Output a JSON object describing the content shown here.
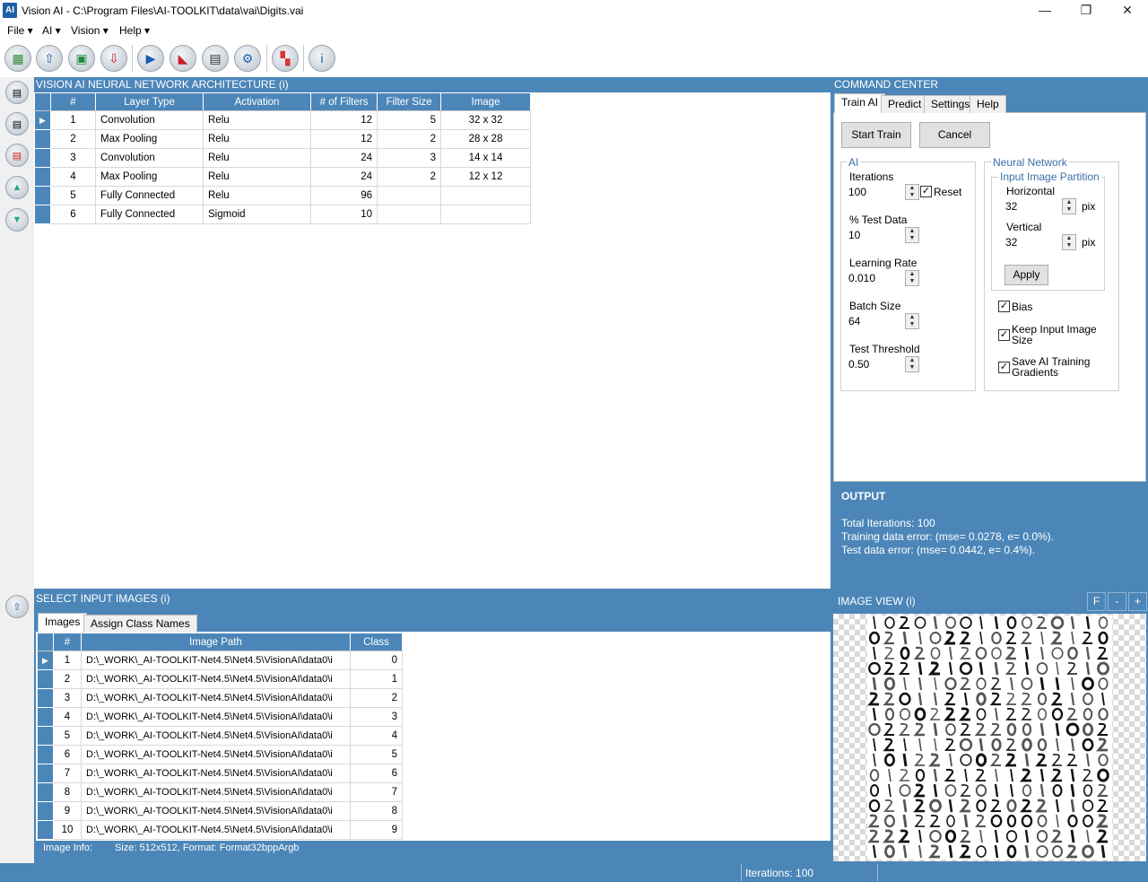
{
  "window": {
    "app_icon": "AI",
    "title": "Vision AI - C:\\Program Files\\AI-TOOLKIT\\data\\vai\\Digits.vai",
    "minimize": "—",
    "restore": "❐",
    "close": "✕"
  },
  "menu": [
    "File",
    "AI",
    "Vision",
    "Help"
  ],
  "toolbar_icons": [
    "new-project-icon",
    "open-icon",
    "save-icon",
    "download-icon",
    "play-icon",
    "train-icon",
    "monitor-icon",
    "settings-icon",
    "color-grid-icon",
    "info-icon"
  ],
  "architecture": {
    "title": "VISION AI NEURAL NETWORK ARCHITECTURE (i)",
    "columns": [
      "#",
      "Layer Type",
      "Activation",
      "# of Filters",
      "Filter Size",
      "Image"
    ],
    "rows": [
      [
        "1",
        "Convolution",
        "Relu",
        "12",
        "5",
        "32 x 32"
      ],
      [
        "2",
        "Max Pooling",
        "Relu",
        "12",
        "2",
        "28 x 28"
      ],
      [
        "3",
        "Convolution",
        "Relu",
        "24",
        "3",
        "14 x 14"
      ],
      [
        "4",
        "Max Pooling",
        "Relu",
        "24",
        "2",
        "12 x 12"
      ],
      [
        "5",
        "Fully Connected",
        "Relu",
        "96",
        "",
        ""
      ],
      [
        "6",
        "Fully Connected",
        "Sigmoid",
        "10",
        "",
        ""
      ]
    ]
  },
  "command_center": {
    "title": "COMMAND CENTER",
    "tabs": [
      "Train AI",
      "Predict",
      "Settings",
      "Help"
    ],
    "start_train": "Start Train",
    "cancel": "Cancel",
    "ai_group": {
      "title": "AI",
      "iterations_label": "Iterations",
      "iterations_value": "100",
      "reset_label": "Reset",
      "test_data_label": "% Test Data",
      "test_data_value": "10",
      "learning_rate_label": "Learning Rate",
      "learning_rate_value": "0.010",
      "batch_size_label": "Batch Size",
      "batch_size_value": "64",
      "test_threshold_label": "Test Threshold",
      "test_threshold_value": "0.50"
    },
    "nn_group": {
      "title": "Neural Network",
      "partition_title": "Input Image Partition",
      "horizontal_label": "Horizontal",
      "horizontal_value": "32",
      "vertical_label": "Vertical",
      "vertical_value": "32",
      "unit": "pix",
      "apply": "Apply",
      "bias_label": "Bias",
      "keep_size_label_1": "Keep Input Image",
      "keep_size_label_2": "Size",
      "save_grad_label_1": "Save AI Training",
      "save_grad_label_2": "Gradients"
    }
  },
  "output": {
    "title": "OUTPUT",
    "lines": [
      "Total Iterations: 100",
      "Training data error: (mse= 0.0278, e= 0.0%).",
      "Test data error: (mse= 0.0442, e= 0.4%)."
    ]
  },
  "input_images": {
    "title": "SELECT INPUT IMAGES (i)",
    "tabs": [
      "Images",
      "Assign Class Names"
    ],
    "columns": [
      "#",
      "Image Path",
      "Class"
    ],
    "rows": [
      [
        "1",
        "D:\\_WORK\\_AI-TOOLKIT-Net4.5\\Net4.5\\VisionAI\\data0\\i",
        "0"
      ],
      [
        "2",
        "D:\\_WORK\\_AI-TOOLKIT-Net4.5\\Net4.5\\VisionAI\\data0\\i",
        "1"
      ],
      [
        "3",
        "D:\\_WORK\\_AI-TOOLKIT-Net4.5\\Net4.5\\VisionAI\\data0\\i",
        "2"
      ],
      [
        "4",
        "D:\\_WORK\\_AI-TOOLKIT-Net4.5\\Net4.5\\VisionAI\\data0\\i",
        "3"
      ],
      [
        "5",
        "D:\\_WORK\\_AI-TOOLKIT-Net4.5\\Net4.5\\VisionAI\\data0\\i",
        "4"
      ],
      [
        "6",
        "D:\\_WORK\\_AI-TOOLKIT-Net4.5\\Net4.5\\VisionAI\\data0\\i",
        "5"
      ],
      [
        "7",
        "D:\\_WORK\\_AI-TOOLKIT-Net4.5\\Net4.5\\VisionAI\\data0\\i",
        "6"
      ],
      [
        "8",
        "D:\\_WORK\\_AI-TOOLKIT-Net4.5\\Net4.5\\VisionAI\\data0\\i",
        "7"
      ],
      [
        "9",
        "D:\\_WORK\\_AI-TOOLKIT-Net4.5\\Net4.5\\VisionAI\\data0\\i",
        "8"
      ],
      [
        "10",
        "D:\\_WORK\\_AI-TOOLKIT-Net4.5\\Net4.5\\VisionAI\\data0\\i",
        "9"
      ]
    ],
    "info_label": "Image Info:",
    "info_value": "Size: 512x512, Format: Format32bppArgb"
  },
  "image_view": {
    "title": "IMAGE VIEW (i)",
    "buttons": [
      "F",
      "-",
      "+"
    ]
  },
  "status": {
    "iterations": "Iterations: 100"
  }
}
